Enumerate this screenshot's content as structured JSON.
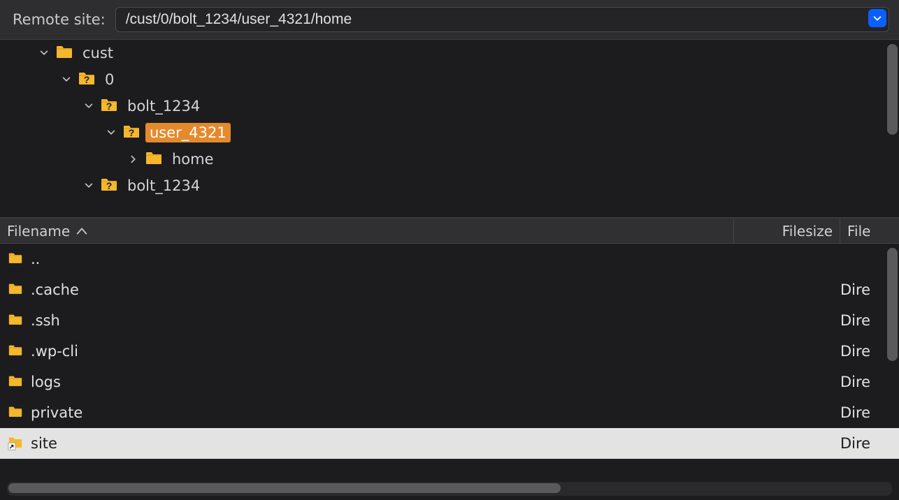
{
  "header": {
    "label": "Remote site:",
    "path": "/cust/0/bolt_1234/user_4321/home"
  },
  "tree": [
    {
      "indent": 1,
      "expander": "down",
      "icon": "folder",
      "label": "cust",
      "selected": false
    },
    {
      "indent": 2,
      "expander": "down",
      "icon": "folder-q",
      "label": "0",
      "selected": false
    },
    {
      "indent": 3,
      "expander": "down",
      "icon": "folder-q",
      "label": "bolt_1234",
      "selected": false
    },
    {
      "indent": 4,
      "expander": "down",
      "icon": "folder-q",
      "label": "user_4321",
      "selected": true
    },
    {
      "indent": 5,
      "expander": "right",
      "icon": "folder",
      "label": "home",
      "selected": false
    },
    {
      "indent": 3,
      "expander": "down",
      "icon": "folder-q",
      "label": "bolt_1234",
      "selected": false
    }
  ],
  "columns": {
    "filename": "Filename",
    "filesize": "Filesize",
    "filetype": "File"
  },
  "files": [
    {
      "icon": "folder",
      "name": "..",
      "size": "",
      "type": "",
      "selected": false
    },
    {
      "icon": "folder",
      "name": ".cache",
      "size": "",
      "type": "Dire",
      "selected": false
    },
    {
      "icon": "folder",
      "name": ".ssh",
      "size": "",
      "type": "Dire",
      "selected": false
    },
    {
      "icon": "folder",
      "name": ".wp-cli",
      "size": "",
      "type": "Dire",
      "selected": false
    },
    {
      "icon": "folder",
      "name": "logs",
      "size": "",
      "type": "Dire",
      "selected": false
    },
    {
      "icon": "folder",
      "name": "private",
      "size": "",
      "type": "Dire",
      "selected": false
    },
    {
      "icon": "shortcut",
      "name": "site",
      "size": "",
      "type": "Dire",
      "selected": true
    }
  ]
}
